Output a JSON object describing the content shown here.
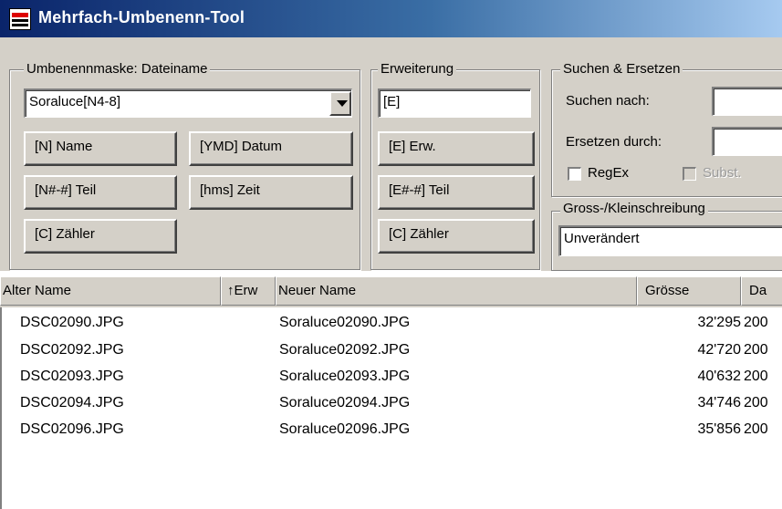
{
  "window": {
    "title": "Mehrfach-Umbenenn-Tool",
    "icon": "app-window-icon"
  },
  "mask_group": {
    "label": "Umbenennmaske: Dateiname",
    "combo_value": "Soraluce[N4-8]",
    "buttons": {
      "name": "[N]  Name",
      "part": "[N#-#] Teil",
      "counter": "[C] Zähler",
      "date": "[YMD]  Datum",
      "time": "[hms]  Zeit"
    }
  },
  "ext_group": {
    "label": "Erweiterung",
    "field_value": "[E]",
    "buttons": {
      "ext": "[E]  Erw.",
      "part": "[E#-#] Teil",
      "counter": "[C]  Zähler"
    }
  },
  "search_group": {
    "label": "Suchen & Ersetzen",
    "search_label": "Suchen nach:",
    "replace_label": "Ersetzen durch:",
    "regex_label": "RegEx",
    "subst_label": "Subst.",
    "search_value": "",
    "replace_value": ""
  },
  "case_group": {
    "label": "Gross-/Kleinschreibung",
    "value": "Unverändert"
  },
  "list": {
    "headers": {
      "old_name": "Alter Name",
      "ext": "↑Erw",
      "new_name": "Neuer Name",
      "size": "Grösse",
      "date": "Da"
    },
    "rows": [
      {
        "old": "DSC02090.JPG",
        "new": "Soraluce02090.JPG",
        "size": "32'295",
        "date": "200"
      },
      {
        "old": "DSC02092.JPG",
        "new": "Soraluce02092.JPG",
        "size": "42'720",
        "date": "200"
      },
      {
        "old": "DSC02093.JPG",
        "new": "Soraluce02093.JPG",
        "size": "40'632",
        "date": "200"
      },
      {
        "old": "DSC02094.JPG",
        "new": "Soraluce02094.JPG",
        "size": "34'746",
        "date": "200"
      },
      {
        "old": "DSC02096.JPG",
        "new": "Soraluce02096.JPG",
        "size": "35'856",
        "date": "200"
      }
    ]
  }
}
